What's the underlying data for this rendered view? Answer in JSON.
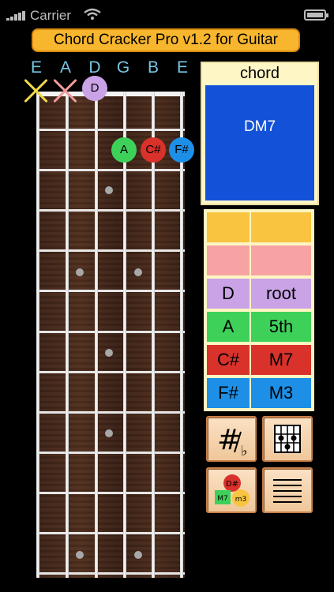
{
  "status_bar": {
    "carrier": "Carrier"
  },
  "app": {
    "title": "Chord Cracker Pro v1.2 for Guitar"
  },
  "strings": [
    "E",
    "A",
    "D",
    "G",
    "B",
    "E"
  ],
  "fretboard": {
    "open_notes": [
      {
        "label": "D",
        "color": "#c9a3e6"
      }
    ],
    "fretted_notes": [
      {
        "label": "A",
        "color": "#3ed15a"
      },
      {
        "label": "C#",
        "color": "#d8322b"
      },
      {
        "label": "F#",
        "color": "#1d8fe6"
      }
    ]
  },
  "chord": {
    "header": "chord",
    "name": "DM7",
    "box_color": "#1352d8"
  },
  "intervals": [
    {
      "note": "",
      "interval": "",
      "color": "#f9c440"
    },
    {
      "note": "",
      "interval": "",
      "color": "#f7a3a3"
    },
    {
      "note": "D",
      "interval": "root",
      "color": "#c9a3e6"
    },
    {
      "note": "A",
      "interval": "5th",
      "color": "#3ed15a"
    },
    {
      "note": "C#",
      "interval": "M7",
      "color": "#d8322b"
    },
    {
      "note": "F#",
      "interval": "M3",
      "color": "#1d8fe6"
    }
  ],
  "tools": {
    "sharp_flat": {
      "sharp": "#",
      "flat": "♭"
    },
    "chord_legend": {
      "top": "D#",
      "left": "M7",
      "right": "m3"
    }
  },
  "colors": {
    "title_bar": "#f7b62d",
    "string_label": "#79c7e3"
  }
}
